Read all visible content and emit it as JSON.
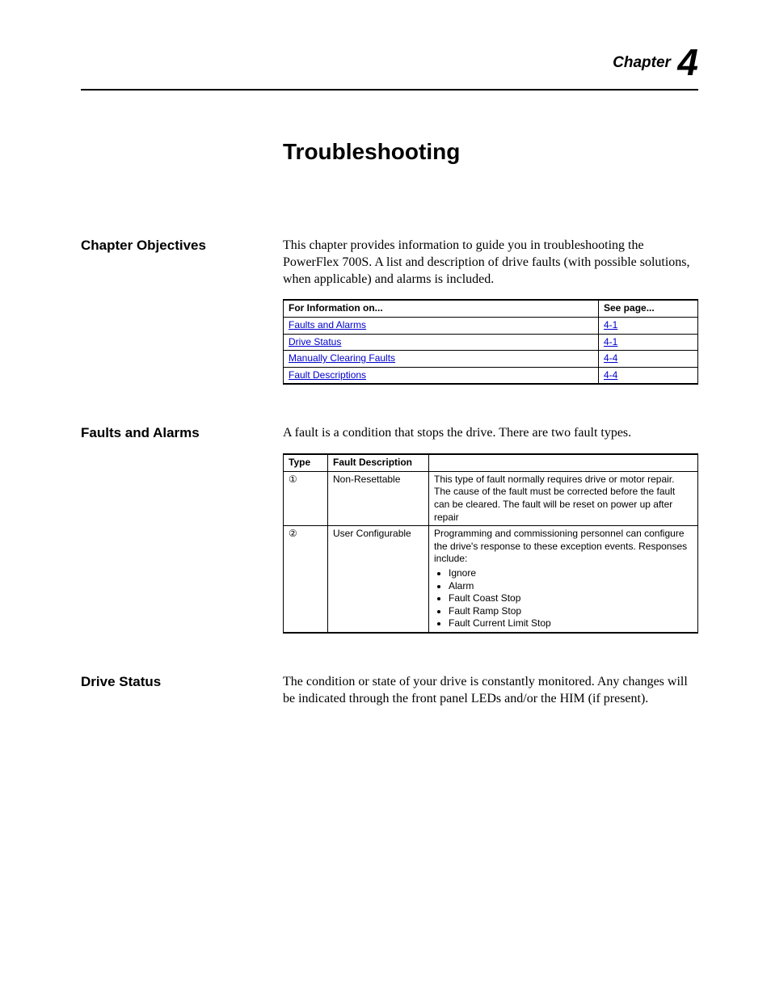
{
  "chapter": {
    "word": "Chapter",
    "num": "4"
  },
  "title": "Troubleshooting",
  "sections": {
    "objectives": {
      "heading": "Chapter Objectives",
      "para": "This chapter provides information to guide you in troubleshooting the PowerFlex 700S. A list and description of drive faults (with possible solutions, when applicable) and alarms is included.",
      "table": {
        "h1": "For Information on...",
        "h2": "See page...",
        "rows": [
          {
            "topic": "Faults and Alarms",
            "page": "4-1"
          },
          {
            "topic": "Drive Status",
            "page": "4-1"
          },
          {
            "topic": "Manually Clearing Faults",
            "page": "4-4"
          },
          {
            "topic": "Fault Descriptions",
            "page": "4-4"
          }
        ]
      }
    },
    "faults": {
      "heading": "Faults and Alarms",
      "para": "A fault is a condition that stops the drive. There are two fault types.",
      "table": {
        "h1": "Type",
        "h2": "Fault Description",
        "rows": [
          {
            "type": "①",
            "name": "Non-Resettable",
            "desc": "This type of fault normally requires drive or motor repair. The cause of the fault must be corrected before the fault can be cleared. The fault will be reset on power up after repair"
          },
          {
            "type": "②",
            "name": "User Configurable",
            "desc_intro": "Programming and commissioning personnel can configure the drive's response to these exception events. Responses include:",
            "bullets": [
              "Ignore",
              "Alarm",
              "Fault Coast Stop",
              "Fault Ramp Stop",
              "Fault Current Limit Stop"
            ]
          }
        ]
      }
    },
    "status": {
      "heading": "Drive Status",
      "para": "The condition or state of your drive is constantly monitored. Any changes will be indicated through the front panel LEDs and/or the HIM (if present)."
    }
  }
}
